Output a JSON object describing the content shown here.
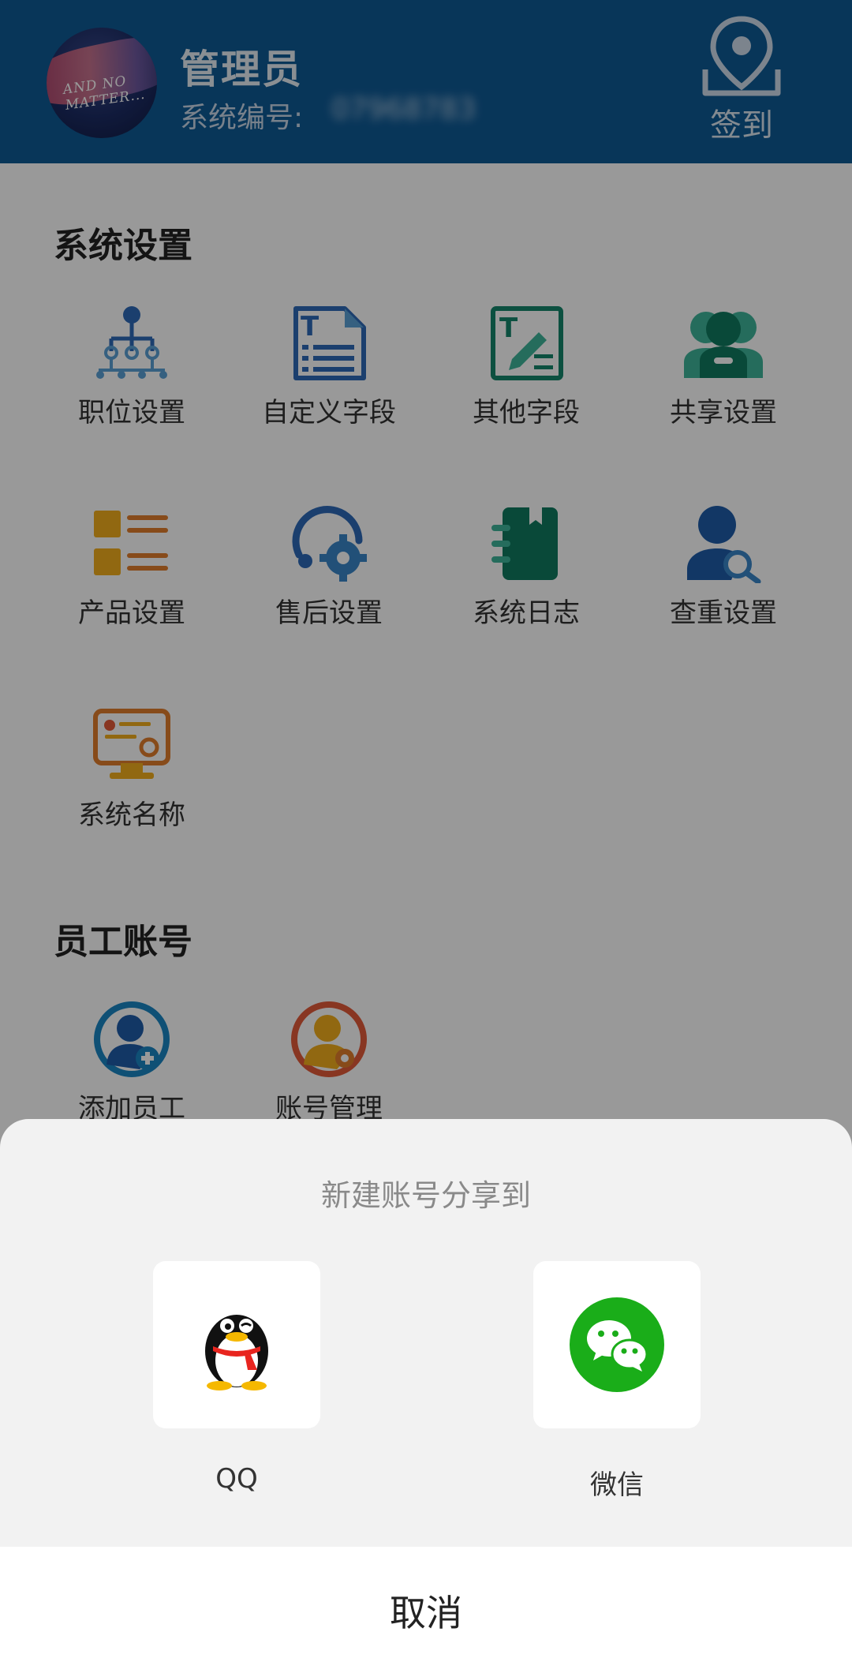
{
  "header": {
    "user_name": "管理员",
    "system_id_label": "系统编号:",
    "system_id_value": "07968783",
    "checkin_label": "签到",
    "avatar_text": "AND NO MATTER..."
  },
  "sections": [
    {
      "title": "系统设置",
      "items": [
        {
          "label": "职位设置",
          "icon": "org-chart-icon"
        },
        {
          "label": "自定义字段",
          "icon": "custom-field-icon"
        },
        {
          "label": "其他字段",
          "icon": "edit-field-icon"
        },
        {
          "label": "共享设置",
          "icon": "share-users-icon"
        },
        {
          "label": "产品设置",
          "icon": "product-list-icon"
        },
        {
          "label": "售后设置",
          "icon": "after-sales-icon"
        },
        {
          "label": "系统日志",
          "icon": "log-book-icon"
        },
        {
          "label": "查重设置",
          "icon": "user-search-icon"
        },
        {
          "label": "系统名称",
          "icon": "monitor-settings-icon"
        }
      ]
    },
    {
      "title": "员工账号",
      "items": [
        {
          "label": "添加员工",
          "icon": "add-user-icon"
        },
        {
          "label": "账号管理",
          "icon": "user-settings-icon"
        }
      ]
    }
  ],
  "share_sheet": {
    "title": "新建账号分享到",
    "options": [
      {
        "label": "QQ",
        "icon": "qq-penguin-icon"
      },
      {
        "label": "微信",
        "icon": "wechat-icon"
      }
    ],
    "cancel": "取消"
  },
  "colors": {
    "header_bg": "#0e5a95",
    "overlay": "rgba(0,0,0,0.40)",
    "sheet_bg": "#f2f2f2",
    "wechat_green": "#1aad19"
  }
}
